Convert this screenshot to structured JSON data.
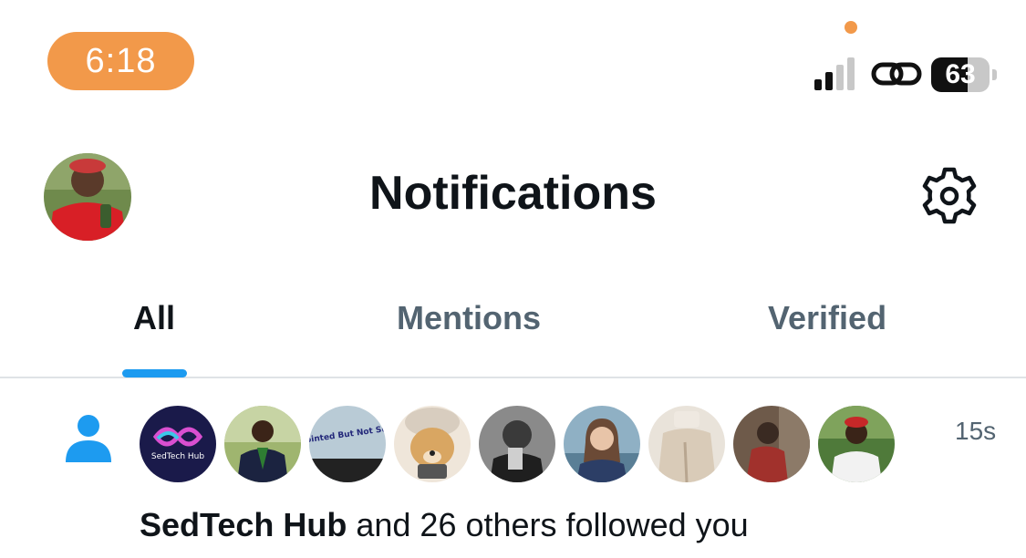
{
  "status_bar": {
    "time": "6:18",
    "battery_level": "63",
    "battery_fraction": 0.63,
    "colors": {
      "time_pill": "#f2994a"
    },
    "icons": [
      "cellular-signal-icon",
      "personal-hotspot-link-icon",
      "battery-icon"
    ]
  },
  "header": {
    "title": "Notifications",
    "icons": [
      "profile-avatar",
      "settings-gear-icon"
    ]
  },
  "tabs": [
    {
      "label": "All",
      "active": true
    },
    {
      "label": "Mentions",
      "active": false
    },
    {
      "label": "Verified",
      "active": false
    }
  ],
  "notification": {
    "type_icon": "person-icon",
    "timestamp": "15s",
    "bold_name": "SedTech Hub",
    "rest_text": " and 26 others followed you",
    "avatars": [
      {
        "name": "sedtech-hub-avatar",
        "label": "SedTech Hub"
      },
      {
        "name": "follower-avatar-2"
      },
      {
        "name": "follower-avatar-3",
        "label": "Disappointed But Not Surprised"
      },
      {
        "name": "follower-avatar-4"
      },
      {
        "name": "follower-avatar-5"
      },
      {
        "name": "follower-avatar-6"
      },
      {
        "name": "follower-avatar-7"
      },
      {
        "name": "follower-avatar-8"
      },
      {
        "name": "follower-avatar-9"
      }
    ]
  },
  "colors": {
    "accent": "#1d9bf0",
    "text_primary": "#0f1419",
    "text_secondary": "#536471",
    "divider": "#dfe3e6"
  }
}
